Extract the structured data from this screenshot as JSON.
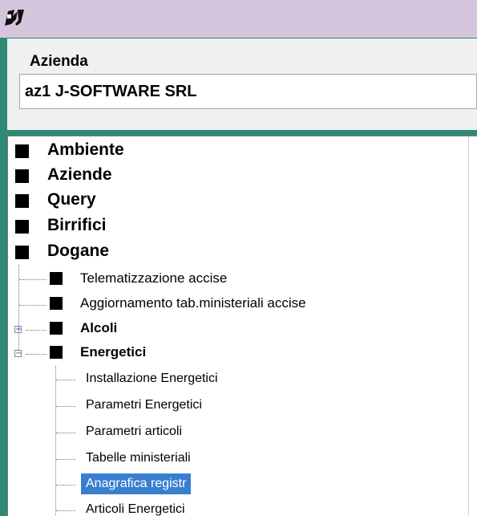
{
  "window": {
    "logo_icon": "app-logo-icon"
  },
  "header": {
    "azienda_label": "Azienda",
    "azienda_value": "az1 J-SOFTWARE SRL"
  },
  "tree": {
    "top_items": [
      "Ambiente",
      "Aziende",
      "Query",
      "Birrifici",
      "Dogane"
    ],
    "dogane_children": [
      {
        "label": "Telematizzazione accise",
        "expander": ""
      },
      {
        "label": "Aggiornamento tab.ministeriali accise",
        "expander": ""
      },
      {
        "label": "Alcoli",
        "expander": "+"
      },
      {
        "label": "Energetici",
        "expander": "−"
      }
    ],
    "energetici_children": [
      "Installazione Energetici",
      "Parametri Energetici",
      "Parametri articoli",
      "Tabelle ministeriali",
      "Anagrafica registr",
      "Articoli Energetici"
    ],
    "selected_item": "Anagrafica registr",
    "colors": {
      "selection": "#3a7fcf",
      "title_bar": "#d6c6dd",
      "frame": "#2e8a74"
    }
  }
}
